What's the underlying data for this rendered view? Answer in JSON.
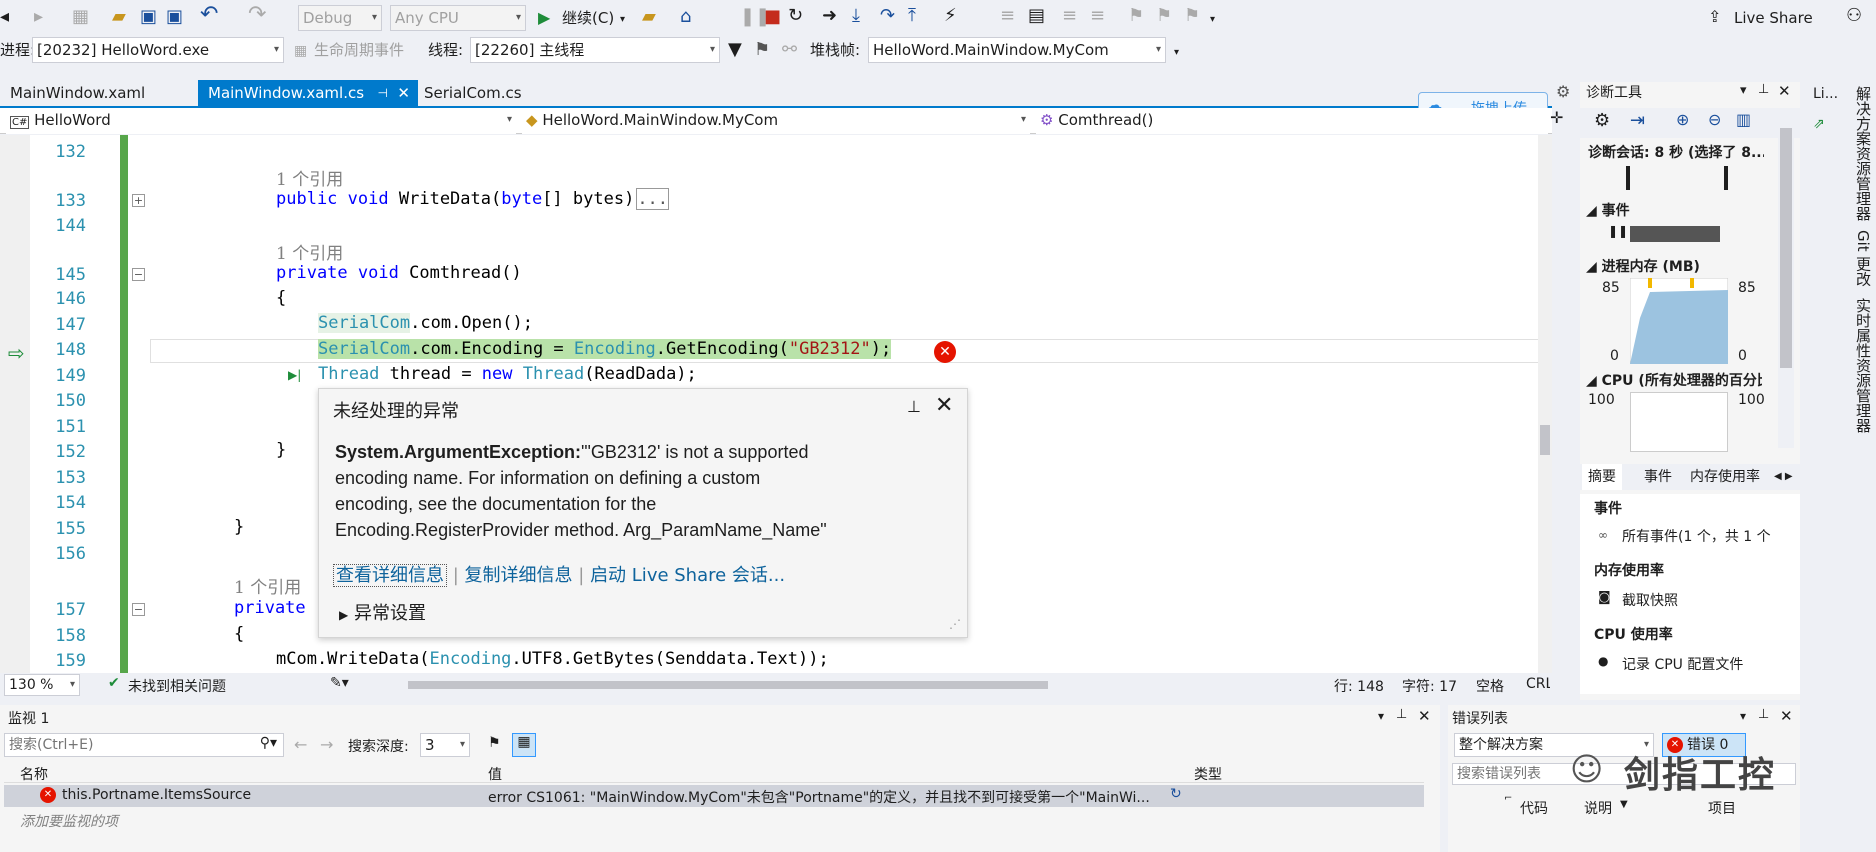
{
  "toolbar": {
    "config": "Debug",
    "platform": "Any CPU",
    "continue_label": "继续(C)",
    "live_share": "Live Share"
  },
  "debugbar": {
    "process_label": "进程:",
    "process_value": "[20232] HelloWord.exe",
    "lifecycle_label": "生命周期事件",
    "thread_label": "线程:",
    "thread_value": "[22260] 主线程",
    "stackframe_label": "堆栈帧:",
    "stackframe_value": "HelloWord.MainWindow.MyCom"
  },
  "tabs": [
    {
      "label": "MainWindow.xaml"
    },
    {
      "label": "MainWindow.xaml.cs"
    },
    {
      "label": "SerialCom.cs"
    }
  ],
  "upload_badge": "拖拽上传",
  "navbar": {
    "project": "HelloWord",
    "class": "HelloWord.MainWindow.MyCom",
    "member": "Comthread()"
  },
  "code": {
    "lines": [
      "132",
      "133",
      "144",
      "145",
      "146",
      "147",
      "148",
      "149",
      "150",
      "151",
      "152",
      "153",
      "154",
      "155",
      "156",
      "157",
      "158",
      "159"
    ],
    "refs": "1 个引用",
    "l133": [
      "public",
      "void",
      "WriteData(",
      "byte",
      "[] bytes)",
      "..."
    ],
    "l145": [
      "private",
      "void",
      "Comthread()"
    ],
    "l147": [
      "SerialCom",
      ".com.Open();"
    ],
    "l148": [
      "SerialCom",
      ".com.Encoding = ",
      "Encoding",
      ".GetEncoding(",
      "\"GB2312\"",
      ");"
    ],
    "l149": [
      "Thread",
      "thread = ",
      "new",
      "Thread",
      "(ReadDada);"
    ],
    "l157": "private",
    "l159": [
      "mCom.WriteData(",
      "Encoding",
      ".UTF8.GetBytes(Senddata.Text));"
    ]
  },
  "exception": {
    "title": "未经处理的异常",
    "type": "System.ArgumentException:",
    "message_line1": "\"'GB2312' is not a supported",
    "message_line2": "encoding name. For information on defining a custom",
    "message_line3": "encoding, see the documentation for the",
    "message_line4": "Encoding.RegisterProvider method. Arg_ParamName_Name\"",
    "link_details": "查看详细信息",
    "link_copy": "复制详细信息",
    "link_liveshare": "启动 Live Share 会话...",
    "settings": "异常设置"
  },
  "status": {
    "zoom": "130 %",
    "issues": "未找到相关问题",
    "line": "行: 148",
    "col": "字符: 17",
    "spacing": "空格",
    "eol": "CRLF"
  },
  "watch": {
    "title": "监视 1",
    "search_placeholder": "搜索(Ctrl+E)",
    "depth_label": "搜索深度:",
    "depth_value": "3",
    "columns": [
      "名称",
      "值",
      "类型"
    ],
    "row_name": "this.Portname.ItemsSource",
    "row_value": "error CS1061: \"MainWindow.MyCom\"未包含\"Portname\"的定义，并且找不到可接受第一个\"MainWi...",
    "add_hint": "添加要监视的项"
  },
  "diag": {
    "title": "诊断工具",
    "session": "诊断会话: 8 秒 (选择了 8...",
    "events": "事件",
    "memory": "进程内存 (MB)",
    "mem_max": "85",
    "mem_min": "0",
    "cpu": "CPU (所有处理器的百分比",
    "cpu_max": "100",
    "tabs": [
      "摘要",
      "事件",
      "内存使用率"
    ],
    "sec_events": "事件",
    "all_events": "所有事件(1 个，共 1 个",
    "sec_memory": "内存使用率",
    "snapshot": "截取快照",
    "sec_cpu": "CPU 使用率",
    "record_cpu": "记录 CPU 配置文件"
  },
  "errors": {
    "title": "错误列表",
    "scope": "整个解决方案",
    "error_count": "错误 0",
    "search_placeholder": "搜索错误列表",
    "col_code": "代码",
    "col_desc": "说明",
    "col_project": "项目"
  },
  "watermark": "剑指工控",
  "right_strip": [
    "Li...",
    "解决方案资源管理器",
    "Git 更改",
    "实时属性资源管理器"
  ]
}
